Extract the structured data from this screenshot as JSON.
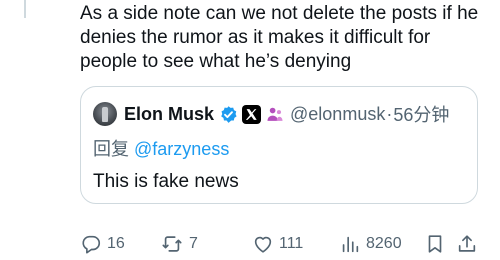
{
  "post": {
    "text": "As a side note can we not delete the posts if he\ndenies the rumor as it makes it difficult for\npeople to see what he’s denying"
  },
  "quote": {
    "author_name": "Elon Musk",
    "handle": "@elonmusk",
    "separator": "·",
    "time": "56分钟",
    "reply_prefix": "回复",
    "reply_mention": "@farzyness",
    "text": "This is fake news"
  },
  "actions": {
    "replies": "16",
    "reposts": "7",
    "likes": "111",
    "views": "8260"
  },
  "icons": {
    "verified": "verified-badge-icon",
    "affiliation": "x-logo-icon",
    "affiliates": "people-icon",
    "reply": "comment-bubble-icon",
    "repost": "repost-arrows-icon",
    "like": "heart-icon",
    "views": "bar-chart-icon",
    "bookmark": "bookmark-icon",
    "share": "share-upload-icon"
  },
  "colors": {
    "text_primary": "#0f1419",
    "text_secondary": "#536471",
    "link": "#1d9bf0",
    "verified": "#1d9bf0",
    "affiliates": "#b44fbd",
    "border": "#cfd9de"
  }
}
